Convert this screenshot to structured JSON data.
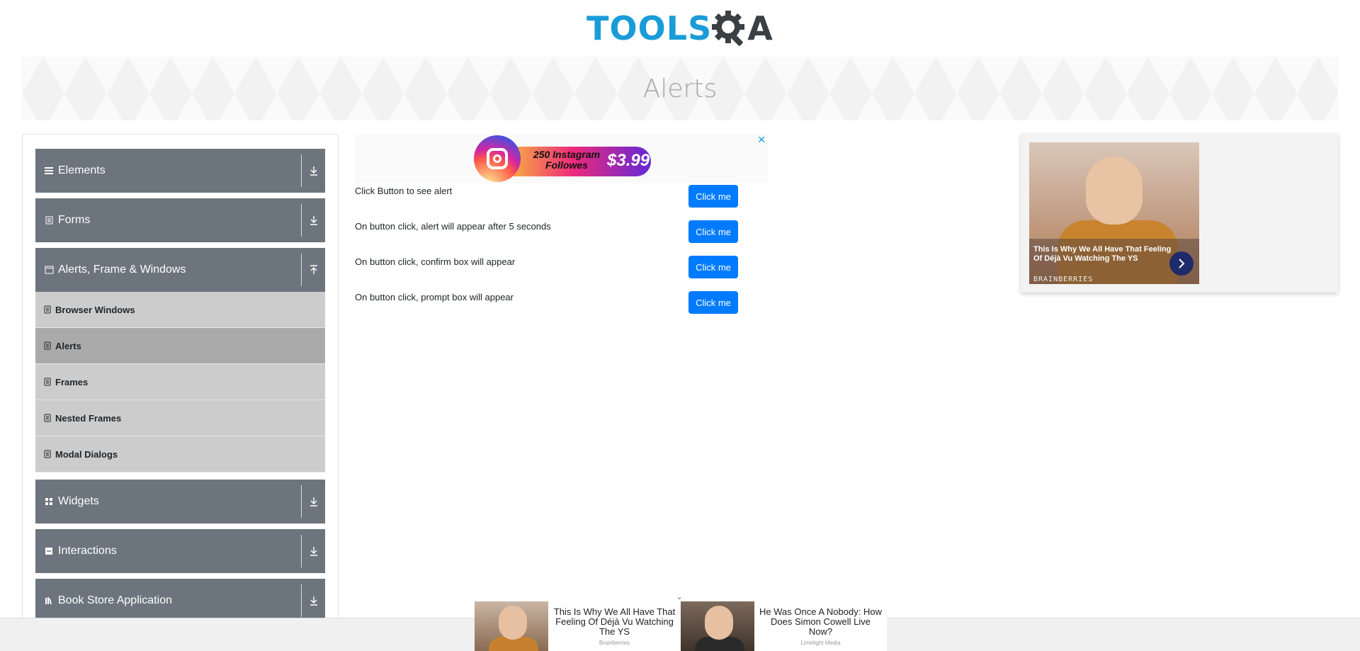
{
  "header": {
    "logo_part1": "TOOLS",
    "logo_part2": "A"
  },
  "banner": {
    "title": "Alerts"
  },
  "sidebar": {
    "groups": [
      {
        "label": "Elements",
        "icon": "hamburger-icon",
        "expanded": false
      },
      {
        "label": "Forms",
        "icon": "form-icon",
        "expanded": false
      },
      {
        "label": "Alerts, Frame & Windows",
        "icon": "window-icon",
        "expanded": true,
        "items": [
          {
            "label": "Browser Windows",
            "active": false
          },
          {
            "label": "Alerts",
            "active": true
          },
          {
            "label": "Frames",
            "active": false
          },
          {
            "label": "Nested Frames",
            "active": false
          },
          {
            "label": "Modal Dialogs",
            "active": false
          }
        ]
      },
      {
        "label": "Widgets",
        "icon": "grid-icon",
        "expanded": false
      },
      {
        "label": "Interactions",
        "icon": "interaction-icon",
        "expanded": false
      },
      {
        "label": "Book Store Application",
        "icon": "books-icon",
        "expanded": false
      }
    ]
  },
  "ad_top": {
    "close": "✕",
    "text": "250 Instagram Followes",
    "price": "$3.99"
  },
  "rows": [
    {
      "label": "Click Button to see alert",
      "button": "Click me"
    },
    {
      "label": "On button click, alert will appear after 5 seconds",
      "button": "Click me"
    },
    {
      "label": "On button click, confirm box will appear",
      "button": "Click me"
    },
    {
      "label": "On button click, prompt box will appear",
      "button": "Click me"
    }
  ],
  "ad_right": {
    "headline": "This Is Why We All Have That Feeling Of Déjà Vu Watching The YS",
    "brand": "BRAINBERRIES"
  },
  "bottom_ads": [
    {
      "headline": "This Is Why We All Have That Feeling Of Déjà Vu Watching The YS",
      "source": "Brainberries"
    },
    {
      "headline": "He Was Once A Nobody: How Does Simon Cowell Live Now?",
      "source": "Limelight Media"
    }
  ],
  "colors": {
    "sidebar_header": "#6c757d",
    "sub_item": "#cccccc",
    "sub_item_active": "#aaaaaa",
    "button": "#007bff",
    "logo_blue": "#1a9cd8"
  }
}
